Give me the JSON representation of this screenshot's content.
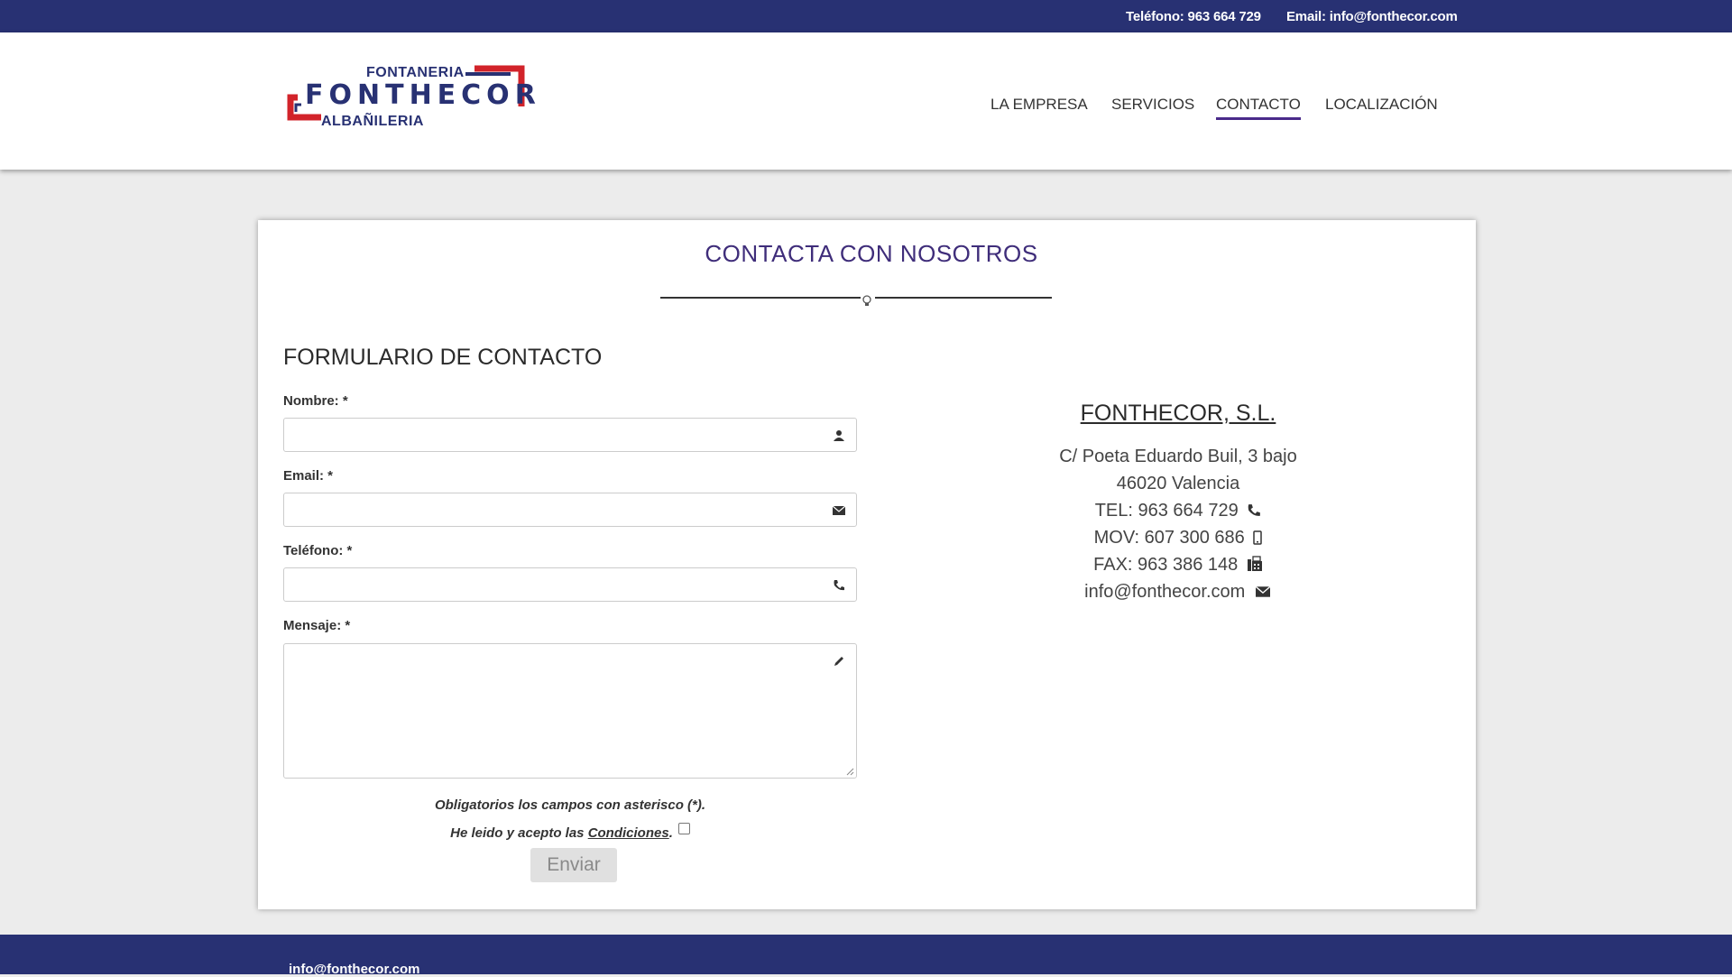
{
  "topbar": {
    "phone": "Teléfono: 963 664 729",
    "email": "Email: info@fonthecor.com"
  },
  "logo": {
    "top": "FONTANERIA",
    "main": "FONTHECOR",
    "bottom": "ALBAÑILERIA"
  },
  "nav": {
    "items": [
      "LA EMPRESA",
      "SERVICIOS",
      "CONTACTO",
      "LOCALIZACIÓN"
    ],
    "active": "CONTACTO"
  },
  "section": {
    "title": "CONTACTA CON NOSOTROS"
  },
  "form": {
    "title": "FORMULARIO DE CONTACTO",
    "name_label": "Nombre: *",
    "email_label": "Email: *",
    "phone_label": "Teléfono: *",
    "message_label": "Mensaje: *",
    "name_value": "",
    "email_value": "",
    "phone_value": "",
    "message_value": "",
    "required_note": "Obligatorios los campos con asterisco (*).",
    "accept_prefix": "He leido y acepto las ",
    "accept_link": "Condiciones",
    "accept_suffix": ".",
    "submit_label": "Enviar"
  },
  "company": {
    "name": "FONTHECOR, S.L.",
    "address1": "C/ Poeta Eduardo Buil, 3 bajo",
    "address2": "46020 Valencia",
    "tel": "TEL: 963 664 729",
    "mov": "MOV: 607 300 686",
    "fax": "FAX: 963 386 148",
    "email": "info@fonthecor.com"
  },
  "footer": {
    "email": "info@fonthecor.com"
  },
  "colors": {
    "brand_blue": "#283173",
    "accent_purple": "#3f2d7a",
    "logo_red": "#d2232a"
  }
}
